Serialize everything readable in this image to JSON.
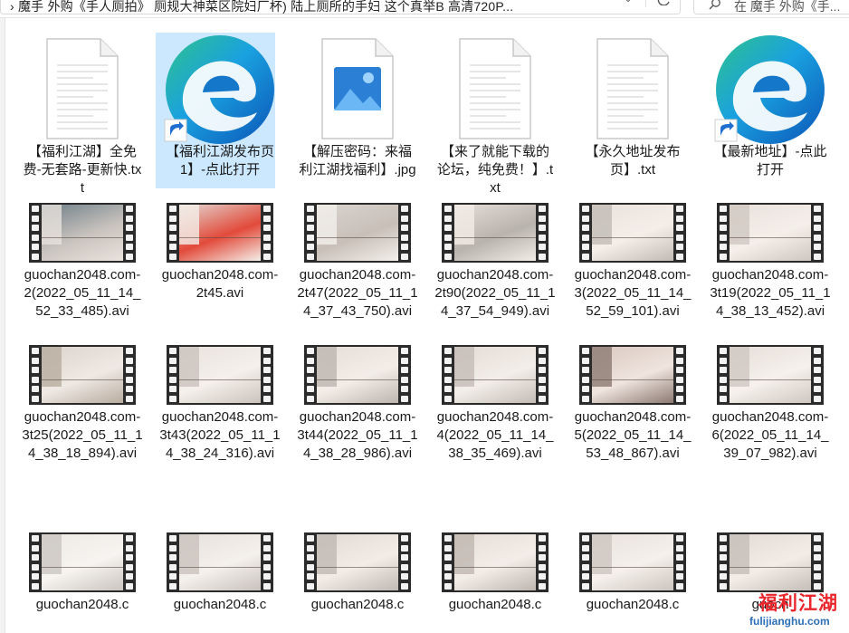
{
  "address_bar": {
    "path": "›  魔手 外购《手人厕拍》 厕规大神菜区院妇厂杯)  陆上厕所的手妇 这个真举B 高清720P..."
  },
  "search": {
    "placeholder": "在 魔手 外购《手..."
  },
  "files": [
    {
      "label": "【福利江湖】全免费-无套路-更新快.txt",
      "type": "txt"
    },
    {
      "label": "【福利江湖发布页1】-点此打开",
      "type": "edge"
    },
    {
      "label": "【解压密码：来福利江湖找福利】.jpg",
      "type": "jpg"
    },
    {
      "label": "【来了就能下载的论坛，纯免费！】.txt",
      "type": "txt"
    },
    {
      "label": "【永久地址发布页】.txt",
      "type": "txt"
    },
    {
      "label": "【最新地址】-点此打开",
      "type": "edge"
    },
    {
      "label": "guochan2048.com-2(2022_05_11_14_52_33_485).avi",
      "type": "video"
    },
    {
      "label": "guochan2048.com-2t45.avi",
      "type": "video"
    },
    {
      "label": "guochan2048.com-2t47(2022_05_11_14_37_43_750).avi",
      "type": "video"
    },
    {
      "label": "guochan2048.com-2t90(2022_05_11_14_37_54_949).avi",
      "type": "video"
    },
    {
      "label": "guochan2048.com-3(2022_05_11_14_52_59_101).avi",
      "type": "video"
    },
    {
      "label": "guochan2048.com-3t19(2022_05_11_14_38_13_452).avi",
      "type": "video"
    },
    {
      "label": "guochan2048.com-3t25(2022_05_11_14_38_18_894).avi",
      "type": "video"
    },
    {
      "label": "guochan2048.com-3t43(2022_05_11_14_38_24_316).avi",
      "type": "video"
    },
    {
      "label": "guochan2048.com-3t44(2022_05_11_14_38_28_986).avi",
      "type": "video"
    },
    {
      "label": "guochan2048.com-4(2022_05_11_14_38_35_469).avi",
      "type": "video"
    },
    {
      "label": "guochan2048.com-5(2022_05_11_14_53_48_867).avi",
      "type": "video"
    },
    {
      "label": "guochan2048.com-6(2022_05_11_14_39_07_982).avi",
      "type": "video"
    },
    {
      "label": "guochan2048.c",
      "type": "video"
    },
    {
      "label": "guochan2048.c",
      "type": "video"
    },
    {
      "label": "guochan2048.c",
      "type": "video"
    },
    {
      "label": "guochan2048.c",
      "type": "video"
    },
    {
      "label": "guochan2048.c",
      "type": "video"
    },
    {
      "label": "guoch",
      "type": "video"
    }
  ],
  "selected_index": 1,
  "watermark": {
    "main": "福利江湖",
    "sub": "fulijianghu.com"
  },
  "colors": {
    "selection": "#cce8ff",
    "watermark_red": "#e8262b",
    "watermark_blue": "#2d6fb8"
  }
}
